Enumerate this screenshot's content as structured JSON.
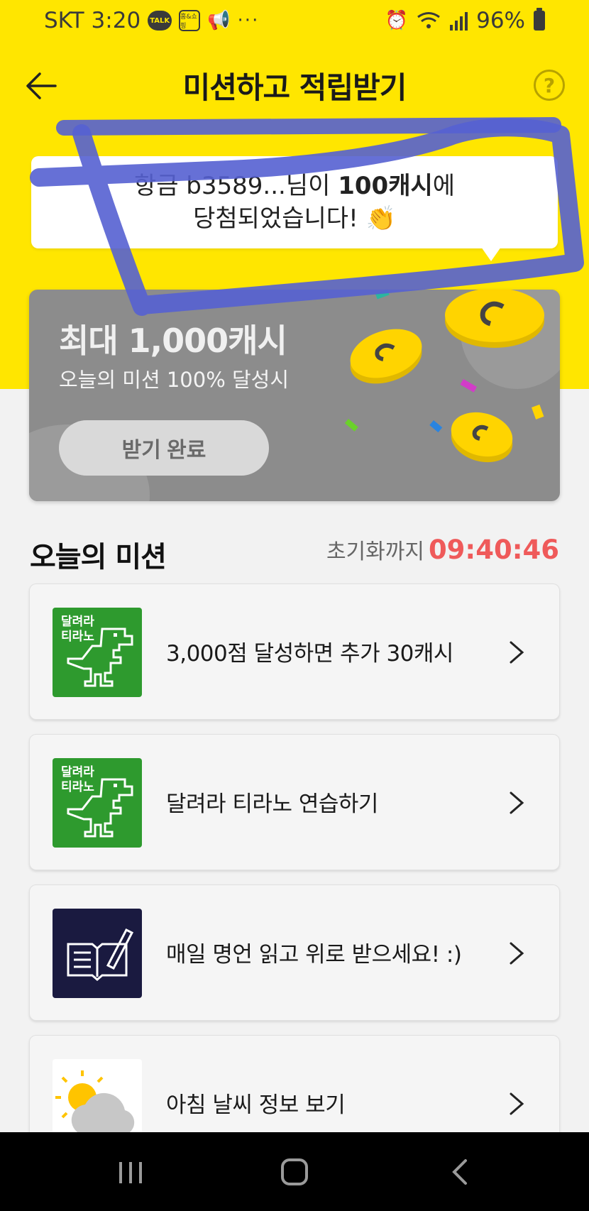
{
  "status_bar": {
    "carrier": "SKT",
    "time": "3:20",
    "badge_talk": "TALK",
    "badge_shop": "홈&쇼핑",
    "overflow": "···",
    "battery": "96%"
  },
  "header": {
    "title": "미션하고 적립받기",
    "help": "?"
  },
  "winner": {
    "line1_prefix": "항금 b3589...님이 ",
    "line1_amount": "100캐시",
    "line1_suffix": "에",
    "line2": "당첨되었습니다! 👏"
  },
  "reward_card": {
    "title": "최대 1,000캐시",
    "subtitle": "오늘의 미션 100% 달성시",
    "button_label": "받기 완료"
  },
  "missions_section": {
    "title": "오늘의 미션",
    "reset_label": "초기화까지",
    "reset_timer": "09:40:46"
  },
  "missions": [
    {
      "label": "3,000점 달성하면 추가 30캐시",
      "thumb": "dino-game",
      "thumb_text": "달려라\n티라노"
    },
    {
      "label": "달려라 티라노 연습하기",
      "thumb": "dino-game",
      "thumb_text": "달려라\n티라노"
    },
    {
      "label": "매일 명언 읽고 위로 받으세요! :)",
      "thumb": "book-pen"
    },
    {
      "label": "아침 날씨 정보 보기",
      "thumb": "weather"
    }
  ],
  "colors": {
    "brand_yellow": "#ffe600",
    "timer_red": "#ef5a5a",
    "dino_green": "#2e9a2e",
    "scribble_blue": "#5560d2"
  }
}
